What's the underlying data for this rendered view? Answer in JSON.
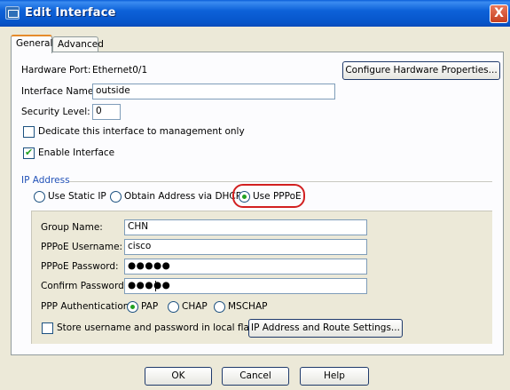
{
  "window": {
    "title": "Edit Interface",
    "close_glyph": "X",
    "icon": "window-app-icon"
  },
  "tabs": [
    {
      "label": "General",
      "active": true
    },
    {
      "label": "Advanced",
      "active": false
    }
  ],
  "general": {
    "hardware_port_label": "Hardware Port:",
    "hardware_port_value": "Ethernet0/1",
    "configure_hw_button": "Configure Hardware Properties...",
    "interface_name_label": "Interface Name:",
    "interface_name_value": "outside",
    "security_level_label": "Security Level:",
    "security_level_value": "0",
    "dedicate_mgmt_label": "Dedicate this interface to management only",
    "dedicate_mgmt_checked": false,
    "enable_interface_label": "Enable Interface",
    "enable_interface_checked": true
  },
  "ip_address": {
    "group_label": "IP Address",
    "options": [
      {
        "label": "Use Static IP",
        "checked": false
      },
      {
        "label": "Obtain Address via DHCP",
        "checked": false
      },
      {
        "label": "Use PPPoE",
        "checked": true
      }
    ]
  },
  "pppoe": {
    "group_name_label": "Group Name:",
    "group_name_value": "CHN",
    "username_label": "PPPoE Username:",
    "username_value": "cisco",
    "password_label": "PPPoE Password:",
    "password_value": "●●●●●",
    "confirm_label": "Confirm Password:",
    "confirm_value": "●●●●●",
    "auth_label": "PPP Authentication:",
    "auth_options": [
      {
        "label": "PAP",
        "checked": true
      },
      {
        "label": "CHAP",
        "checked": false
      },
      {
        "label": "MSCHAP",
        "checked": false
      }
    ],
    "store_flash_label": "Store username and password in local flash",
    "store_flash_checked": false,
    "route_settings_button": "IP Address and Route Settings..."
  },
  "footer": {
    "ok": "OK",
    "cancel": "Cancel",
    "help": "Help"
  },
  "colors": {
    "titlebar": "#0a5fd8",
    "accent_tab": "#e68b2c",
    "group_title": "#2252b8",
    "highlight": "#d22020",
    "check": "#21a121"
  }
}
